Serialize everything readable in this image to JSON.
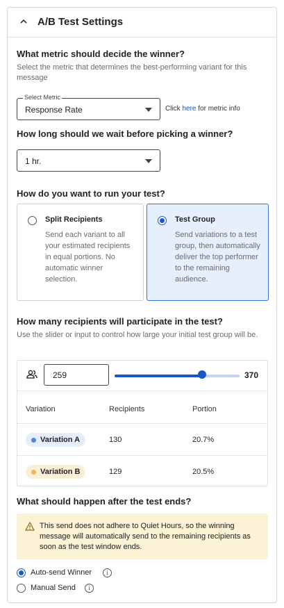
{
  "header": {
    "title": "A/B Test Settings"
  },
  "metric": {
    "question": "What metric should decide the winner?",
    "description": "Select the metric that determines the best-performing variant for this message",
    "select_legend": "Select Metric",
    "select_value": "Response Rate",
    "hint_prefix": "Click ",
    "hint_link": "here",
    "hint_suffix": " for metric info"
  },
  "wait": {
    "question": "How long should we wait before picking a winner?",
    "select_value": "1 hr."
  },
  "run": {
    "question": "How do you want to run your test?",
    "options": [
      {
        "title": "Split Recipients",
        "description": "Send each variant to all your estimated recipients in equal portions. No automatic winner selection.",
        "selected": false
      },
      {
        "title": "Test Group",
        "description": "Send variations to a test group, then automatically deliver the top performer to the remaining audience.",
        "selected": true
      }
    ]
  },
  "recipients": {
    "question": "How many recipients will participate in the test?",
    "description": "Use the slider or input to control how large your initial test group will be.",
    "input_value": "259",
    "slider_value": 259,
    "slider_max": 370,
    "max_label": "370",
    "columns": [
      "Variation",
      "Recipients",
      "Portion"
    ],
    "rows": [
      {
        "variation": "Variation A",
        "recipients": "130",
        "portion": "20.7%",
        "color": "#4f86e8",
        "bg": "#e6eefc"
      },
      {
        "variation": "Variation B",
        "recipients": "129",
        "portion": "20.5%",
        "color": "#f0b74f",
        "bg": "#fcefd7"
      }
    ]
  },
  "after": {
    "question": "What should happen after the test ends?",
    "warning": "This send does not adhere to Quiet Hours, so the winning message will automatically send to the remaining recipients as soon as the test window ends.",
    "options": [
      {
        "label": "Auto-send Winner",
        "selected": true
      },
      {
        "label": "Manual Send",
        "selected": false
      }
    ],
    "info_glyph": "i"
  },
  "colors": {
    "accent": "#1a56c7",
    "selected_card_bg": "#e6effc",
    "warning_bg": "#fbf1d5"
  }
}
